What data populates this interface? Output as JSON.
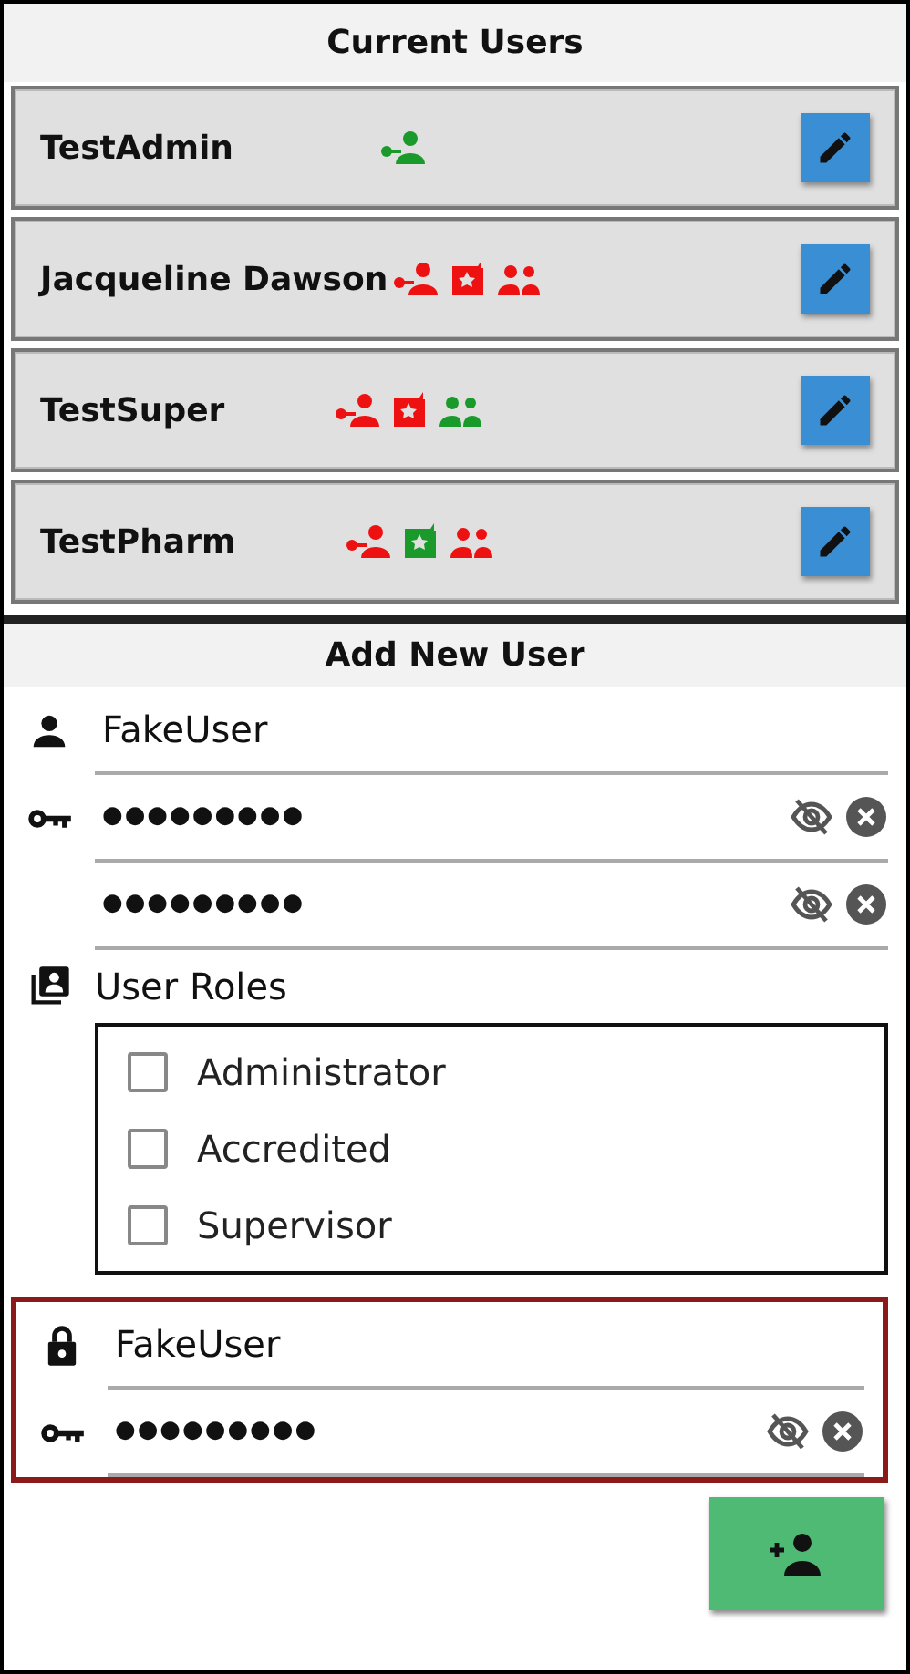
{
  "current_users": {
    "title": "Current Users",
    "users": [
      {
        "name": "TestAdmin",
        "roles": [
          {
            "kind": "admin",
            "granted": true
          }
        ]
      },
      {
        "name": "Jacqueline Dawson",
        "roles": [
          {
            "kind": "admin",
            "granted": false
          },
          {
            "kind": "accredited",
            "granted": false
          },
          {
            "kind": "supervisor",
            "granted": false
          }
        ]
      },
      {
        "name": "TestSuper",
        "roles": [
          {
            "kind": "admin",
            "granted": false
          },
          {
            "kind": "accredited",
            "granted": false
          },
          {
            "kind": "supervisor",
            "granted": true
          }
        ]
      },
      {
        "name": "TestPharm",
        "roles": [
          {
            "kind": "admin",
            "granted": false
          },
          {
            "kind": "accredited",
            "granted": true
          },
          {
            "kind": "supervisor",
            "granted": false
          }
        ]
      }
    ]
  },
  "add_new_user": {
    "title": "Add New User",
    "username": {
      "value": "FakeUser"
    },
    "password": {
      "value": "●●●●●●●●●"
    },
    "confirm_password": {
      "value": "●●●●●●●●●"
    },
    "roles_label": "User Roles",
    "roles": [
      {
        "label": "Administrator",
        "checked": false
      },
      {
        "label": "Accredited",
        "checked": false
      },
      {
        "label": "Supervisor",
        "checked": false
      }
    ],
    "authorization": {
      "highlighted": true,
      "username": {
        "value": "FakeUser"
      },
      "password": {
        "value": "●●●●●●●●●"
      }
    }
  }
}
